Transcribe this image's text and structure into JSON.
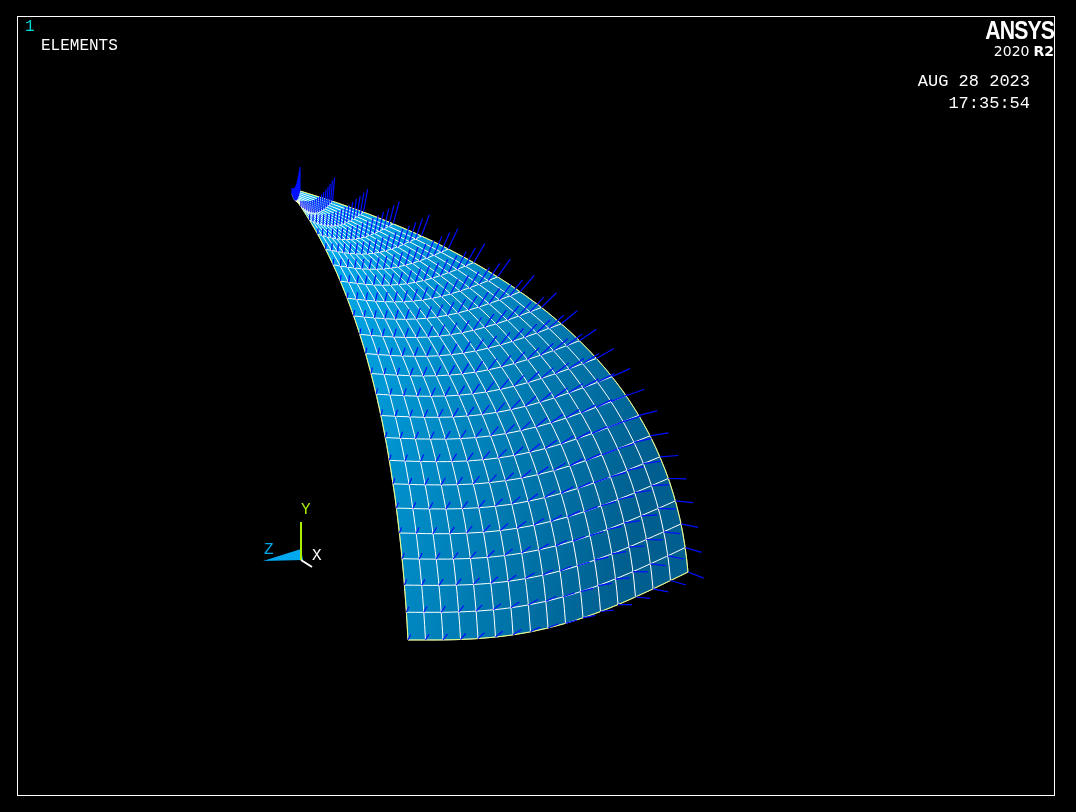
{
  "window_number": "1",
  "title": "ELEMENTS",
  "logo": {
    "name": "ANSYS",
    "version": "2020",
    "release": "R2"
  },
  "date": "AUG 28 2023",
  "time": "17:35:54",
  "triad": [
    {
      "axis": "Y"
    },
    {
      "axis": "Z"
    },
    {
      "axis": "X"
    }
  ]
}
